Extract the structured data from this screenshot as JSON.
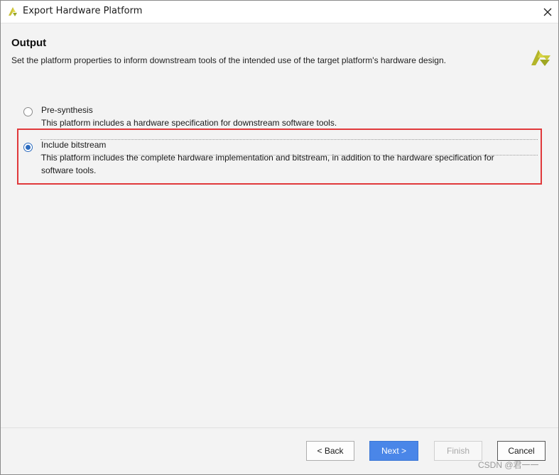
{
  "window": {
    "title": "Export Hardware Platform",
    "close_icon": "close-icon",
    "app_icon": "vivado-logo-icon"
  },
  "header": {
    "title": "Output",
    "description": "Set the platform properties to inform downstream tools of the intended use of the target platform's hardware design.",
    "logo_icon": "vivado-logo-icon",
    "logo_color": "#b6b52a"
  },
  "options": [
    {
      "label": "Pre-synthesis",
      "description": "This platform includes a hardware specification for downstream software tools.",
      "selected": false
    },
    {
      "label": "Include bitstream",
      "description": "This platform includes the complete hardware implementation and bitstream, in addition to the hardware specification for software tools.",
      "selected": true
    }
  ],
  "buttons": {
    "back": "< Back",
    "next": "Next >",
    "finish": "Finish",
    "cancel": "Cancel"
  },
  "watermark": "CSDN @君一一",
  "colors": {
    "accent": "#4a86e8",
    "highlight": "#e0393b"
  }
}
